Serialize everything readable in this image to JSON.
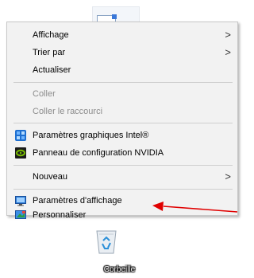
{
  "context_menu": {
    "items": [
      {
        "label": "Affichage",
        "has_submenu": true,
        "disabled": false
      },
      {
        "label": "Trier par",
        "has_submenu": true,
        "disabled": false
      },
      {
        "label": "Actualiser",
        "has_submenu": false,
        "disabled": false
      },
      {
        "label": "Coller",
        "has_submenu": false,
        "disabled": true
      },
      {
        "label": "Coller le raccourci",
        "has_submenu": false,
        "disabled": true
      },
      {
        "label": "Paramètres graphiques Intel®",
        "icon": "intel-graphics-icon",
        "has_submenu": false,
        "disabled": false
      },
      {
        "label": "Panneau de configuration NVIDIA",
        "icon": "nvidia-icon",
        "has_submenu": false,
        "disabled": false
      },
      {
        "label": "Nouveau",
        "has_submenu": true,
        "disabled": false
      },
      {
        "label": "Paramètres d'affichage",
        "icon": "display-settings-icon",
        "has_submenu": false,
        "disabled": false
      },
      {
        "label": "Personnaliser",
        "icon": "personalize-icon",
        "has_submenu": false,
        "disabled": false
      }
    ],
    "submenu_arrow": ">"
  },
  "desktop": {
    "recycle_bin_label": "Corbeille"
  },
  "annotation": {
    "arrow_color": "#e00000",
    "points_to": "Paramètres d'affichage"
  },
  "colors": {
    "menu_bg": "#f2f2f2",
    "disabled_text": "#8c8c8c",
    "nvidia_green": "#76b900",
    "intel_blue": "#1e6fd0"
  }
}
